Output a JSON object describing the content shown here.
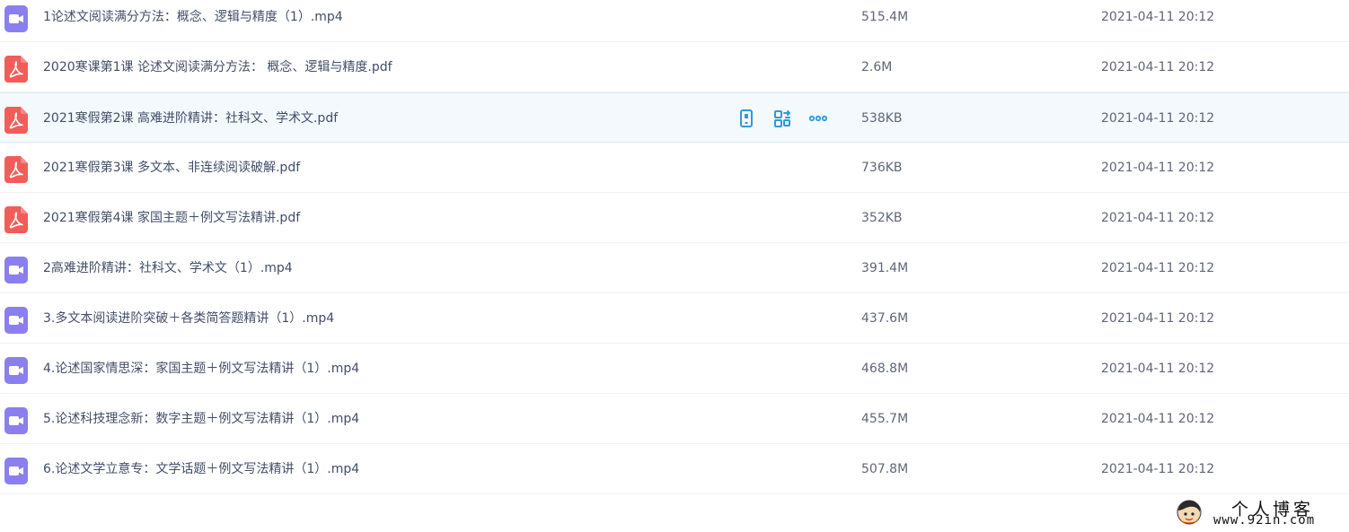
{
  "colors": {
    "video_icon": "#8b7ff0",
    "pdf_icon": "#f25d5a",
    "action_icon": "#2e9ae0",
    "selected_row_bg": "#f4f9fe"
  },
  "files": [
    {
      "icon": "video-file-icon",
      "name": "1论述文阅读满分方法：概念、逻辑与精度（1）.mp4",
      "size": "515.4M",
      "date": "2021-04-11 20:12"
    },
    {
      "icon": "pdf-file-icon",
      "name": "2020寒课第1课 论述文阅读满分方法： 概念、逻辑与精度.pdf",
      "size": "2.6M",
      "date": "2021-04-11 20:12"
    },
    {
      "icon": "pdf-file-icon",
      "name": "2021寒假第2课 高难进阶精讲：社科文、学术文.pdf",
      "size": "538KB",
      "date": "2021-04-11 20:12"
    },
    {
      "icon": "pdf-file-icon",
      "name": "2021寒假第3课 多文本、非连续阅读破解.pdf",
      "size": "736KB",
      "date": "2021-04-11 20:12"
    },
    {
      "icon": "pdf-file-icon",
      "name": "2021寒假第4课 家国主题＋例文写法精讲.pdf",
      "size": "352KB",
      "date": "2021-04-11 20:12"
    },
    {
      "icon": "video-file-icon",
      "name": "2高难进阶精讲：社科文、学术文（1）.mp4",
      "size": "391.4M",
      "date": "2021-04-11 20:12"
    },
    {
      "icon": "video-file-icon",
      "name": "3.多文本阅读进阶突破＋各类简答题精讲（1）.mp4",
      "size": "437.6M",
      "date": "2021-04-11 20:12"
    },
    {
      "icon": "video-file-icon",
      "name": "4.论述国家情思深：家国主题＋例文写法精讲（1）.mp4",
      "size": "468.8M",
      "date": "2021-04-11 20:12"
    },
    {
      "icon": "video-file-icon",
      "name": "5.论述科技理念新：数字主题＋例文写法精讲（1）.mp4",
      "size": "455.7M",
      "date": "2021-04-11 20:12"
    },
    {
      "icon": "video-file-icon",
      "name": "6.论述文学立意专：文学话题＋例文写法精讲（1）.mp4",
      "size": "507.8M",
      "date": "2021-04-11 20:12"
    }
  ],
  "selected_row_index": 2,
  "row_actions": [
    "phone-icon",
    "share-icon",
    "more-icon"
  ],
  "watermark": {
    "title": "个人博客",
    "url": "www.92in.com"
  }
}
